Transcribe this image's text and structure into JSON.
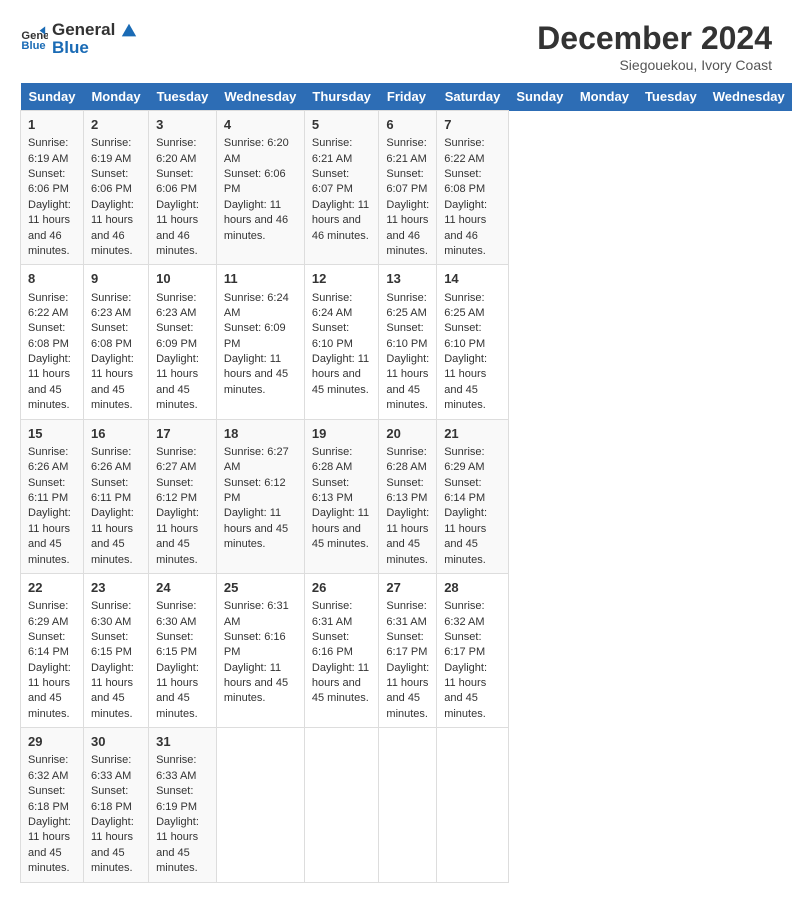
{
  "header": {
    "logo_line1": "General",
    "logo_line2": "Blue",
    "month": "December 2024",
    "location": "Siegouekou, Ivory Coast"
  },
  "weekdays": [
    "Sunday",
    "Monday",
    "Tuesday",
    "Wednesday",
    "Thursday",
    "Friday",
    "Saturday"
  ],
  "weeks": [
    [
      {
        "day": "1",
        "sunrise": "Sunrise: 6:19 AM",
        "sunset": "Sunset: 6:06 PM",
        "daylight": "Daylight: 11 hours and 46 minutes."
      },
      {
        "day": "2",
        "sunrise": "Sunrise: 6:19 AM",
        "sunset": "Sunset: 6:06 PM",
        "daylight": "Daylight: 11 hours and 46 minutes."
      },
      {
        "day": "3",
        "sunrise": "Sunrise: 6:20 AM",
        "sunset": "Sunset: 6:06 PM",
        "daylight": "Daylight: 11 hours and 46 minutes."
      },
      {
        "day": "4",
        "sunrise": "Sunrise: 6:20 AM",
        "sunset": "Sunset: 6:06 PM",
        "daylight": "Daylight: 11 hours and 46 minutes."
      },
      {
        "day": "5",
        "sunrise": "Sunrise: 6:21 AM",
        "sunset": "Sunset: 6:07 PM",
        "daylight": "Daylight: 11 hours and 46 minutes."
      },
      {
        "day": "6",
        "sunrise": "Sunrise: 6:21 AM",
        "sunset": "Sunset: 6:07 PM",
        "daylight": "Daylight: 11 hours and 46 minutes."
      },
      {
        "day": "7",
        "sunrise": "Sunrise: 6:22 AM",
        "sunset": "Sunset: 6:08 PM",
        "daylight": "Daylight: 11 hours and 46 minutes."
      }
    ],
    [
      {
        "day": "8",
        "sunrise": "Sunrise: 6:22 AM",
        "sunset": "Sunset: 6:08 PM",
        "daylight": "Daylight: 11 hours and 45 minutes."
      },
      {
        "day": "9",
        "sunrise": "Sunrise: 6:23 AM",
        "sunset": "Sunset: 6:08 PM",
        "daylight": "Daylight: 11 hours and 45 minutes."
      },
      {
        "day": "10",
        "sunrise": "Sunrise: 6:23 AM",
        "sunset": "Sunset: 6:09 PM",
        "daylight": "Daylight: 11 hours and 45 minutes."
      },
      {
        "day": "11",
        "sunrise": "Sunrise: 6:24 AM",
        "sunset": "Sunset: 6:09 PM",
        "daylight": "Daylight: 11 hours and 45 minutes."
      },
      {
        "day": "12",
        "sunrise": "Sunrise: 6:24 AM",
        "sunset": "Sunset: 6:10 PM",
        "daylight": "Daylight: 11 hours and 45 minutes."
      },
      {
        "day": "13",
        "sunrise": "Sunrise: 6:25 AM",
        "sunset": "Sunset: 6:10 PM",
        "daylight": "Daylight: 11 hours and 45 minutes."
      },
      {
        "day": "14",
        "sunrise": "Sunrise: 6:25 AM",
        "sunset": "Sunset: 6:10 PM",
        "daylight": "Daylight: 11 hours and 45 minutes."
      }
    ],
    [
      {
        "day": "15",
        "sunrise": "Sunrise: 6:26 AM",
        "sunset": "Sunset: 6:11 PM",
        "daylight": "Daylight: 11 hours and 45 minutes."
      },
      {
        "day": "16",
        "sunrise": "Sunrise: 6:26 AM",
        "sunset": "Sunset: 6:11 PM",
        "daylight": "Daylight: 11 hours and 45 minutes."
      },
      {
        "day": "17",
        "sunrise": "Sunrise: 6:27 AM",
        "sunset": "Sunset: 6:12 PM",
        "daylight": "Daylight: 11 hours and 45 minutes."
      },
      {
        "day": "18",
        "sunrise": "Sunrise: 6:27 AM",
        "sunset": "Sunset: 6:12 PM",
        "daylight": "Daylight: 11 hours and 45 minutes."
      },
      {
        "day": "19",
        "sunrise": "Sunrise: 6:28 AM",
        "sunset": "Sunset: 6:13 PM",
        "daylight": "Daylight: 11 hours and 45 minutes."
      },
      {
        "day": "20",
        "sunrise": "Sunrise: 6:28 AM",
        "sunset": "Sunset: 6:13 PM",
        "daylight": "Daylight: 11 hours and 45 minutes."
      },
      {
        "day": "21",
        "sunrise": "Sunrise: 6:29 AM",
        "sunset": "Sunset: 6:14 PM",
        "daylight": "Daylight: 11 hours and 45 minutes."
      }
    ],
    [
      {
        "day": "22",
        "sunrise": "Sunrise: 6:29 AM",
        "sunset": "Sunset: 6:14 PM",
        "daylight": "Daylight: 11 hours and 45 minutes."
      },
      {
        "day": "23",
        "sunrise": "Sunrise: 6:30 AM",
        "sunset": "Sunset: 6:15 PM",
        "daylight": "Daylight: 11 hours and 45 minutes."
      },
      {
        "day": "24",
        "sunrise": "Sunrise: 6:30 AM",
        "sunset": "Sunset: 6:15 PM",
        "daylight": "Daylight: 11 hours and 45 minutes."
      },
      {
        "day": "25",
        "sunrise": "Sunrise: 6:31 AM",
        "sunset": "Sunset: 6:16 PM",
        "daylight": "Daylight: 11 hours and 45 minutes."
      },
      {
        "day": "26",
        "sunrise": "Sunrise: 6:31 AM",
        "sunset": "Sunset: 6:16 PM",
        "daylight": "Daylight: 11 hours and 45 minutes."
      },
      {
        "day": "27",
        "sunrise": "Sunrise: 6:31 AM",
        "sunset": "Sunset: 6:17 PM",
        "daylight": "Daylight: 11 hours and 45 minutes."
      },
      {
        "day": "28",
        "sunrise": "Sunrise: 6:32 AM",
        "sunset": "Sunset: 6:17 PM",
        "daylight": "Daylight: 11 hours and 45 minutes."
      }
    ],
    [
      {
        "day": "29",
        "sunrise": "Sunrise: 6:32 AM",
        "sunset": "Sunset: 6:18 PM",
        "daylight": "Daylight: 11 hours and 45 minutes."
      },
      {
        "day": "30",
        "sunrise": "Sunrise: 6:33 AM",
        "sunset": "Sunset: 6:18 PM",
        "daylight": "Daylight: 11 hours and 45 minutes."
      },
      {
        "day": "31",
        "sunrise": "Sunrise: 6:33 AM",
        "sunset": "Sunset: 6:19 PM",
        "daylight": "Daylight: 11 hours and 45 minutes."
      },
      null,
      null,
      null,
      null
    ]
  ]
}
